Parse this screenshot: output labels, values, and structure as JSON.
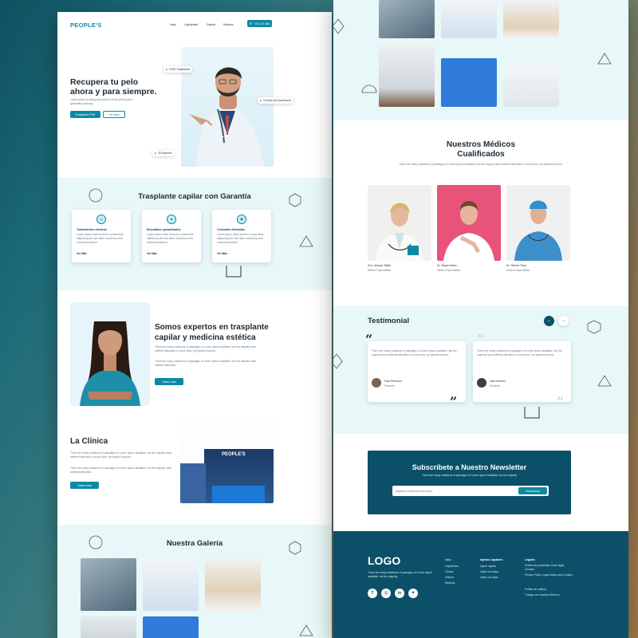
{
  "colors": {
    "primary": "#0d8aa3",
    "dark": "#0b4a63",
    "mint": "#e6f7f6",
    "footer": "#0b5068"
  },
  "nav": {
    "logo": "PEOPLE'S",
    "links": [
      "Inicio",
      "Capilaridad",
      "Galería",
      "Médicos"
    ],
    "phone_btn": "+34 123 456"
  },
  "hero": {
    "title_line1": "Recupera tu pelo",
    "title_line2": "ahora y para siempre.",
    "text": "Lorem ipsum is simply dummy text of the printing and typesetting industry.",
    "btn_primary": "Trasplante FUE",
    "btn_secondary": "Ver Más",
    "badge1": "2.500 Trasplantes",
    "badge2": "15 Años de Experiencia",
    "badge3": "25 Expertos"
  },
  "garantia": {
    "title": "Trasplante capilar con Garantía",
    "cards": [
      {
        "title": "Tratamientos médicos",
        "text": "Lorem ipsum dolor sit amet, consectetur adipiscing elit, sed diam nonummy nibh euismod tincidunt",
        "link": "Ver Más"
      },
      {
        "title": "Resultados garantizados",
        "text": "Lorem ipsum dolor sit amet, consectetur adipiscing elit, sed diam nonummy nibh euismod tincidunt",
        "link": "Ver Más"
      },
      {
        "title": "Consultas ilimitadas",
        "text": "Lorem ipsum dolor sit amet, consectetur adipiscing elit, sed diam nonummy nibh euismod tincidunt",
        "link": "Ver Más"
      }
    ]
  },
  "expertos": {
    "title_line1": "Somos expertos en trasplante",
    "title_line2": "capilar y medicina estética",
    "p1": "There are many variations of passages of Lorem Ipsum available, but the majority have suffered alteration in some form, by injected humour.",
    "p2": "There are many variations of passages of Lorem Ipsum available, but the majority have suffered alteration.",
    "btn": "Saber más"
  },
  "clinica": {
    "title": "La Clínica",
    "p1": "There are many variations of passages of Lorem Ipsum available, but the majority have suffered alteration in some form, by injected humour.",
    "p2": "There are many variations of passages of Lorem Ipsum available, but the majority have suffered alteration.",
    "btn": "Saber más",
    "sign": "PEOPLE'S"
  },
  "galeria": {
    "title": "Nuestra Galería"
  },
  "medicos": {
    "title_line1": "Nuestros Médicos",
    "title_line2": "Cualificados",
    "subtitle": "There are many variations of passages of Lorem Ipsum available, but the majority have suffered alteration in some form, by injected humour.",
    "doctors": [
      {
        "name": "Dra. Jessica Tailler",
        "role": "Médico Especialista"
      },
      {
        "name": "Dr. Bryan Adam",
        "role": "Médico Especialista"
      },
      {
        "name": "Dr. Steven Terry",
        "role": "Médico Especialista"
      }
    ]
  },
  "testimonial": {
    "title": "Testimonial",
    "items": [
      {
        "text": "There are many variations of passages of Lorem Ipsum available, but the majority have suffered alteration in some form, by injected humour.",
        "name": "Paul Peterson",
        "role": "Paciente"
      },
      {
        "text": "There are many variations of passages of Lorem Ipsum available, but the majority have suffered alteration in some form, by injected humour.",
        "name": "Jack Moreno",
        "role": "Paciente"
      }
    ]
  },
  "newsletter": {
    "title": "Subscríbete a Nuestro Newsletter",
    "subtitle": "There are many variations of passages of Lorem Ipsum available, but the majority",
    "placeholder": "Ingrese tu dirección de correo",
    "btn": "Suscribirse"
  },
  "footer": {
    "logo": "LOGO",
    "text": "There are many variations of passages of Lorem Ipsum available, but the majority",
    "col1": [
      "Inicio",
      "Capilaridad",
      "Clínica",
      "Galería",
      "Médicos"
    ],
    "col2_title": "Injertos Capilares",
    "col2": [
      "Injerto capilar",
      "Injerto de barba",
      "Injerto de cejas"
    ],
    "col3_title": "Legales",
    "col3": [
      "Política de privacidad, Aviso legal, Cookies",
      "Privacy Policy, Legal Notice and Cookies",
      "Política de calidad",
      "Trabaja con nosotros Work us"
    ]
  }
}
